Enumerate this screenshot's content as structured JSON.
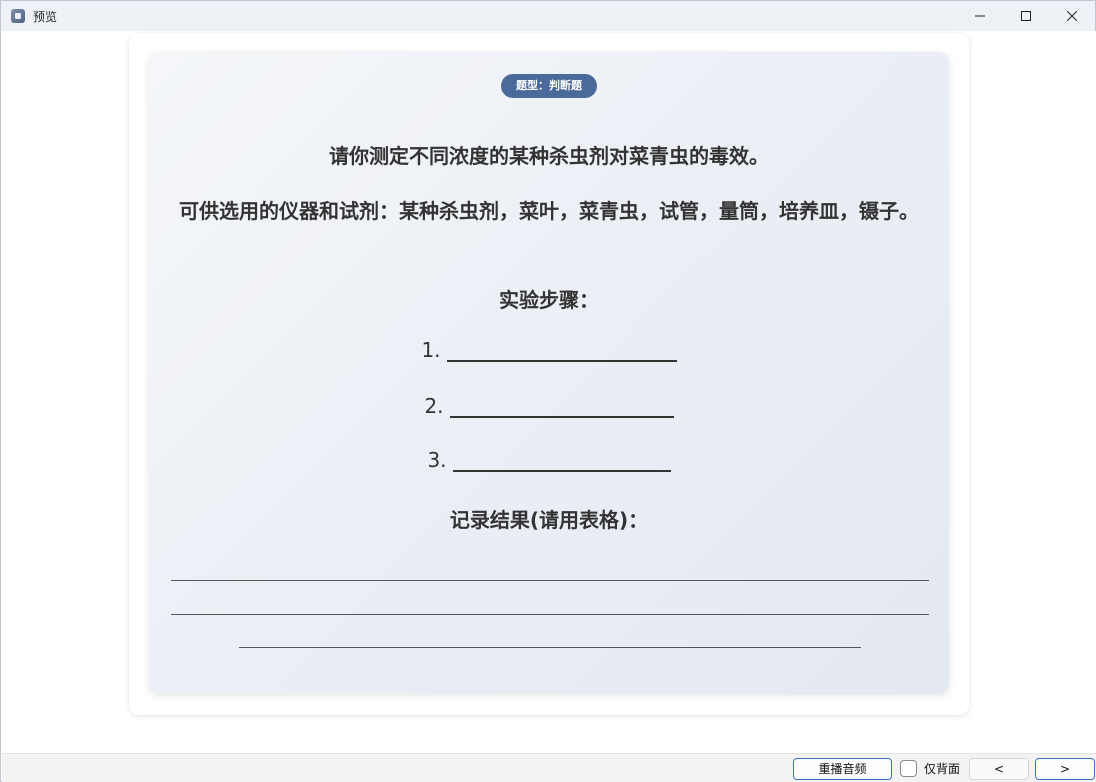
{
  "window": {
    "title": "预览",
    "controls": {
      "minimize": "minimize-icon",
      "maximize": "maximize-icon",
      "close": "close-icon"
    }
  },
  "question": {
    "type_badge": "题型：判断题",
    "title": "请你测定不同浓度的某种杀虫剂对菜青虫的毒效。",
    "materials": "可供选用的仪器和试剂：某种杀虫剂，菜叶，菜青虫，试管，量筒，培养皿，镊子。",
    "steps_heading": "实验步骤：",
    "steps": [
      {
        "num": "1."
      },
      {
        "num": "2."
      },
      {
        "num": "3."
      }
    ],
    "record_heading": "记录结果(请用表格)："
  },
  "bottombar": {
    "replay_label": "重播音频",
    "back_only_label": "仅背面",
    "back_only_checked": false,
    "prev_label": "<",
    "next_label": ">"
  },
  "colors": {
    "badge": "#4a6a9b",
    "accent_border": "#3b6fc4"
  }
}
